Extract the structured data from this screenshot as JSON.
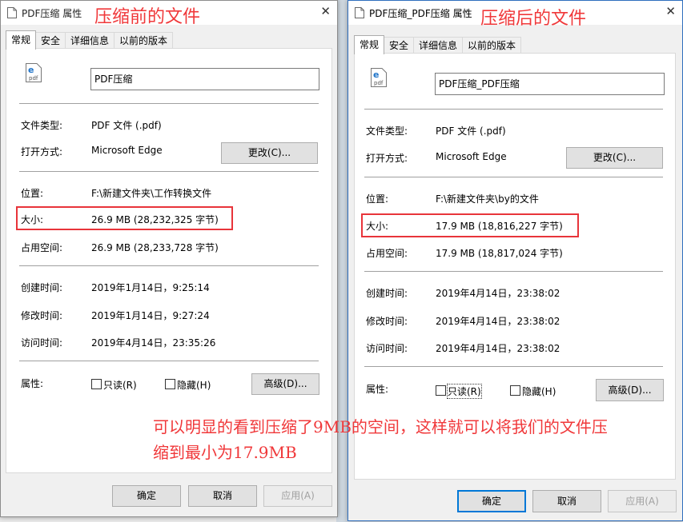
{
  "left": {
    "title": "PDF压缩 属性",
    "overlay": "压缩前的文件",
    "tabs": [
      "常规",
      "安全",
      "详细信息",
      "以前的版本"
    ],
    "filename": "PDF压缩",
    "type_label": "文件类型:",
    "type_value": "PDF 文件 (.pdf)",
    "open_label": "打开方式:",
    "open_value": "Microsoft Edge",
    "change_btn": "更改(C)...",
    "loc_label": "位置:",
    "loc_value": "F:\\新建文件夹\\工作转换文件",
    "size_label": "大小:",
    "size_value": "26.9 MB (28,232,325 字节)",
    "disk_label": "占用空间:",
    "disk_value": "26.9 MB (28,233,728 字节)",
    "created_label": "创建时间:",
    "created_value": "2019年1月14日，9:25:14",
    "modified_label": "修改时间:",
    "modified_value": "2019年1月14日，9:27:24",
    "accessed_label": "访问时间:",
    "accessed_value": "2019年4月14日，23:35:26",
    "attr_label": "属性:",
    "readonly": "只读(R)",
    "hidden": "隐藏(H)",
    "advanced_btn": "高级(D)...",
    "ok": "确定",
    "cancel": "取消",
    "apply": "应用(A)"
  },
  "right": {
    "title": "PDF压缩_PDF压缩 属性",
    "overlay": "压缩后的文件",
    "tabs": [
      "常规",
      "安全",
      "详细信息",
      "以前的版本"
    ],
    "filename": "PDF压缩_PDF压缩",
    "type_label": "文件类型:",
    "type_value": "PDF 文件 (.pdf)",
    "open_label": "打开方式:",
    "open_value": "Microsoft Edge",
    "change_btn": "更改(C)...",
    "loc_label": "位置:",
    "loc_value": "F:\\新建文件夹\\by的文件",
    "size_label": "大小:",
    "size_value": "17.9 MB (18,816,227 字节)",
    "disk_label": "占用空间:",
    "disk_value": "17.9 MB (18,817,024 字节)",
    "created_label": "创建时间:",
    "created_value": "2019年4月14日，23:38:02",
    "modified_label": "修改时间:",
    "modified_value": "2019年4月14日，23:38:02",
    "accessed_label": "访问时间:",
    "accessed_value": "2019年4月14日，23:38:02",
    "attr_label": "属性:",
    "readonly": "只读(R)",
    "hidden": "隐藏(H)",
    "advanced_btn": "高级(D)...",
    "ok": "确定",
    "cancel": "取消",
    "apply": "应用(A)"
  },
  "annotation": {
    "line1": "可以明显的看到压缩了9MB的空间，这样就可以将我们的文件压",
    "line2": "缩到最小为17.9MB"
  },
  "colors": {
    "annotation_red": "#f0383a",
    "focus_blue": "#0078d7"
  }
}
